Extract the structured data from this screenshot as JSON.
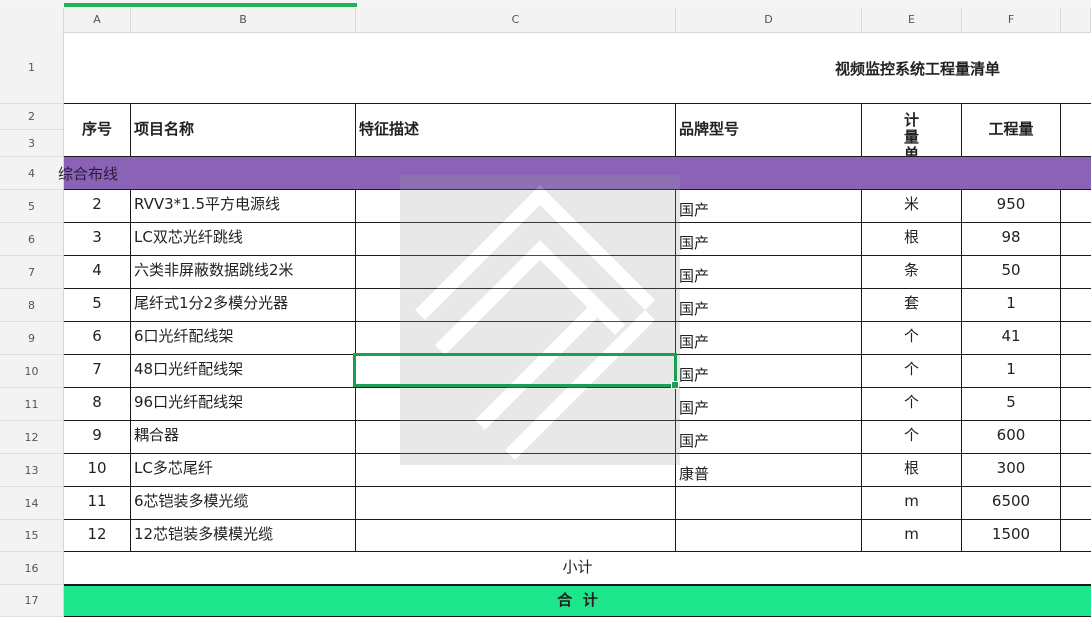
{
  "sheet": {
    "title": "视频监控系统工程量清单",
    "columns": [
      "A",
      "B",
      "C",
      "D",
      "E",
      "F"
    ],
    "row_numbers": [
      "1",
      "2",
      "3",
      "4",
      "5",
      "6",
      "7",
      "8",
      "9",
      "10",
      "11",
      "12",
      "13",
      "14",
      "15",
      "16",
      "17"
    ],
    "headers": {
      "seq": "序号",
      "name": "项目名称",
      "desc": "特征描述",
      "brand": "品牌型号",
      "unit": "计量单位",
      "qty": "工程量"
    },
    "section_label": "综合布线",
    "rows": [
      {
        "seq": "2",
        "name": "RVV3*1.5平方电源线",
        "brand": "国产",
        "unit": "米",
        "qty": "950"
      },
      {
        "seq": "3",
        "name": "LC双芯光纤跳线",
        "brand": "国产",
        "unit": "根",
        "qty": "98"
      },
      {
        "seq": "4",
        "name": "六类非屏蔽数据跳线2米",
        "brand": "国产",
        "unit": "条",
        "qty": "50"
      },
      {
        "seq": "5",
        "name": "尾纤式1分2多模分光器",
        "brand": "国产",
        "unit": "套",
        "qty": "1"
      },
      {
        "seq": "6",
        "name": "6口光纤配线架",
        "brand": "国产",
        "unit": "个",
        "qty": "41"
      },
      {
        "seq": "7",
        "name": "48口光纤配线架",
        "brand": "国产",
        "unit": "个",
        "qty": "1"
      },
      {
        "seq": "8",
        "name": "96口光纤配线架",
        "brand": "国产",
        "unit": "个",
        "qty": "5"
      },
      {
        "seq": "9",
        "name": "耦合器",
        "brand": "国产",
        "unit": "个",
        "qty": "600"
      },
      {
        "seq": "10",
        "name": "LC多芯尾纤",
        "brand": "康普",
        "unit": "根",
        "qty": "300"
      },
      {
        "seq": "11",
        "name": "6芯铠装多模光缆",
        "brand": "",
        "unit": "m",
        "qty": "6500"
      },
      {
        "seq": "12",
        "name": "12芯铠装多模模光缆",
        "brand": "",
        "unit": "m",
        "qty": "1500"
      }
    ],
    "subtotal_label": "小计",
    "total_label": "合  计",
    "selected_cell": "C10",
    "colors": {
      "section_band": "#8b63b6",
      "total_band": "#1de58c",
      "selection": "#1c9e55"
    }
  }
}
